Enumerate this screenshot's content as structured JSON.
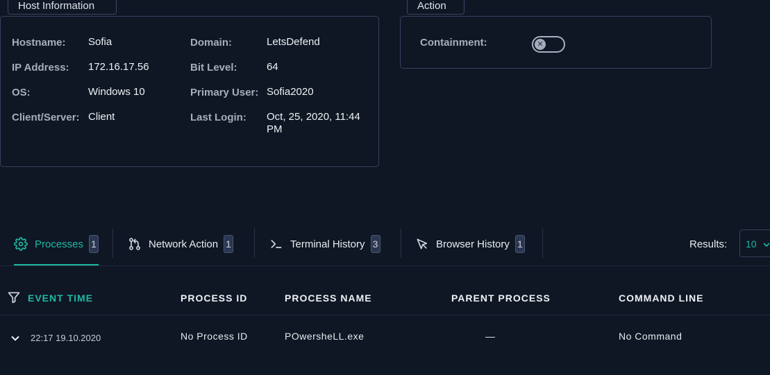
{
  "host_info": {
    "tab_label": "Host Information",
    "fields": [
      {
        "label": "Hostname:",
        "value": "Sofia"
      },
      {
        "label": "IP Address:",
        "value": "172.16.17.56"
      },
      {
        "label": "OS:",
        "value": "Windows 10"
      },
      {
        "label": "Client/Server:",
        "value": "Client"
      },
      {
        "label": "Domain:",
        "value": "LetsDefend"
      },
      {
        "label": "Bit Level:",
        "value": "64"
      },
      {
        "label": "Primary User:",
        "value": "Sofia2020"
      },
      {
        "label": "Last Login:",
        "value": "Oct, 25, 2020, 11:44 PM"
      }
    ]
  },
  "action": {
    "tab_label": "Action",
    "containment_label": "Containment:",
    "containment_on": false,
    "toggle_glyph": "✕"
  },
  "tabs": [
    {
      "label": "Processes",
      "count": "1",
      "icon": "gear-icon",
      "active": true
    },
    {
      "label": "Network Action",
      "count": "1",
      "icon": "git-branch-icon",
      "active": false
    },
    {
      "label": "Terminal History",
      "count": "3",
      "icon": "terminal-icon",
      "active": false
    },
    {
      "label": "Browser History",
      "count": "1",
      "icon": "cursor-icon",
      "active": false
    }
  ],
  "results": {
    "label": "Results:",
    "value": "10"
  },
  "table": {
    "headers": [
      "EVENT TIME",
      "PROCESS ID",
      "PROCESS NAME",
      "PARENT PROCESS",
      "COMMAND LINE"
    ],
    "rows": [
      {
        "event_time": "22:17 19.10.2020",
        "process_id": "No Process ID",
        "process_name": "POwersheLL.exe",
        "parent_process": "—",
        "command_line": "No Command"
      }
    ]
  },
  "colors": {
    "accent": "#1fb8a2",
    "background": "#0f1724",
    "border": "#354260"
  }
}
